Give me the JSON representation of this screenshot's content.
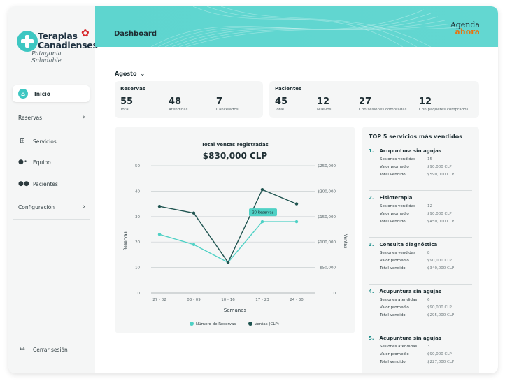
{
  "brand": {
    "name_line1": "Terapias",
    "name_line2": "Canadienses",
    "tagline": "Patagonia Saludable",
    "app_line1": "Agenda",
    "app_line2": "ahora"
  },
  "header": {
    "title": "Dashboard"
  },
  "sidebar": {
    "items": [
      {
        "label": "Inicio",
        "icon": "home-icon"
      },
      {
        "label": "Reservas",
        "icon": "chevron-right-icon"
      },
      {
        "label": "Servicios",
        "icon": "plus-square-icon"
      },
      {
        "label": "Equipo",
        "icon": "team-icon"
      },
      {
        "label": "Pacientes",
        "icon": "patients-icon"
      },
      {
        "label": "Configuración",
        "icon": "chevron-right-icon"
      }
    ],
    "logout": "Cerrar sesión"
  },
  "filter": {
    "month": "Agosto"
  },
  "reservas": {
    "title": "Reservas",
    "stats": [
      {
        "value": "55",
        "label": "Total"
      },
      {
        "value": "48",
        "label": "Atendidas"
      },
      {
        "value": "7",
        "label": "Cancelados"
      }
    ]
  },
  "pacientes": {
    "title": "Pacientes",
    "stats": [
      {
        "value": "45",
        "label": "Total"
      },
      {
        "value": "12",
        "label": "Nuevos"
      },
      {
        "value": "27",
        "label": "Con sesiones compradas"
      },
      {
        "value": "12",
        "label": "Con paquetes comprados"
      }
    ]
  },
  "chart_data": {
    "type": "line",
    "title": "Total ventas registradas",
    "subtitle": "$830,000 CLP",
    "xlabel": "Semanas",
    "ylabel_left": "Reservas",
    "ylabel_right": "Ventas",
    "categories": [
      "27 - 02",
      "03 - 09",
      "10 - 16",
      "17 - 23",
      "24 - 30"
    ],
    "y_left_ticks": [
      "0",
      "10",
      "20",
      "30",
      "40",
      "50"
    ],
    "y_right_ticks": [
      "0",
      "$50,000",
      "$100,000",
      "$150,000",
      "$200,000",
      "$250,000"
    ],
    "ylim_left": [
      0,
      50
    ],
    "ylim_right": [
      0,
      250000
    ],
    "series": [
      {
        "name": "Número de Reservas",
        "axis": "left",
        "color": "#4fd1c5",
        "values": [
          23,
          19,
          12,
          28,
          28
        ]
      },
      {
        "name": "Ventas (CLP)",
        "axis": "right",
        "color": "#1f5450",
        "values": [
          170000,
          157000,
          60000,
          203000,
          175000
        ]
      }
    ],
    "tooltip": "30 Reservas",
    "grid": true,
    "legend_position": "bottom"
  },
  "top5": {
    "title": "TOP 5 servicios más vendidos",
    "items": [
      {
        "n": "1.",
        "name": "Acupuntura sin agujas",
        "rows": [
          [
            "Sesiones vendidas",
            "15"
          ],
          [
            "Valor promedio",
            "$90,000 CLP"
          ],
          [
            "Total vendido",
            "$590,000 CLP"
          ]
        ]
      },
      {
        "n": "2.",
        "name": "Fisioterapia",
        "rows": [
          [
            "Sesiones vendidas",
            "12"
          ],
          [
            "Valor promedio",
            "$90,000 CLP"
          ],
          [
            "Total vendido",
            "$450,000 CLP"
          ]
        ]
      },
      {
        "n": "3.",
        "name": "Consulta diagnóstica",
        "rows": [
          [
            "Sesiones vendidas",
            "8"
          ],
          [
            "Valor promedio",
            "$90,000 CLP"
          ],
          [
            "Total vendido",
            "$340,000 CLP"
          ]
        ]
      },
      {
        "n": "4.",
        "name": "Acupuntura sin agujas",
        "rows": [
          [
            "Sesiones atendidas",
            "6"
          ],
          [
            "Valor promedio",
            "$90,000 CLP"
          ],
          [
            "Total vendido",
            "$295,000 CLP"
          ]
        ]
      },
      {
        "n": "5.",
        "name": "Acupuntura sin agujas",
        "rows": [
          [
            "Sesiones atendidas",
            "3"
          ],
          [
            "Valor promedio",
            "$90,000 CLP"
          ],
          [
            "Total vendido",
            "$227,000 CLP"
          ]
        ]
      }
    ]
  },
  "colors": {
    "accent": "#3ec7c2",
    "dark_series": "#1f5450",
    "light_series": "#4fd1c5",
    "brand_orange": "#e8730d"
  }
}
